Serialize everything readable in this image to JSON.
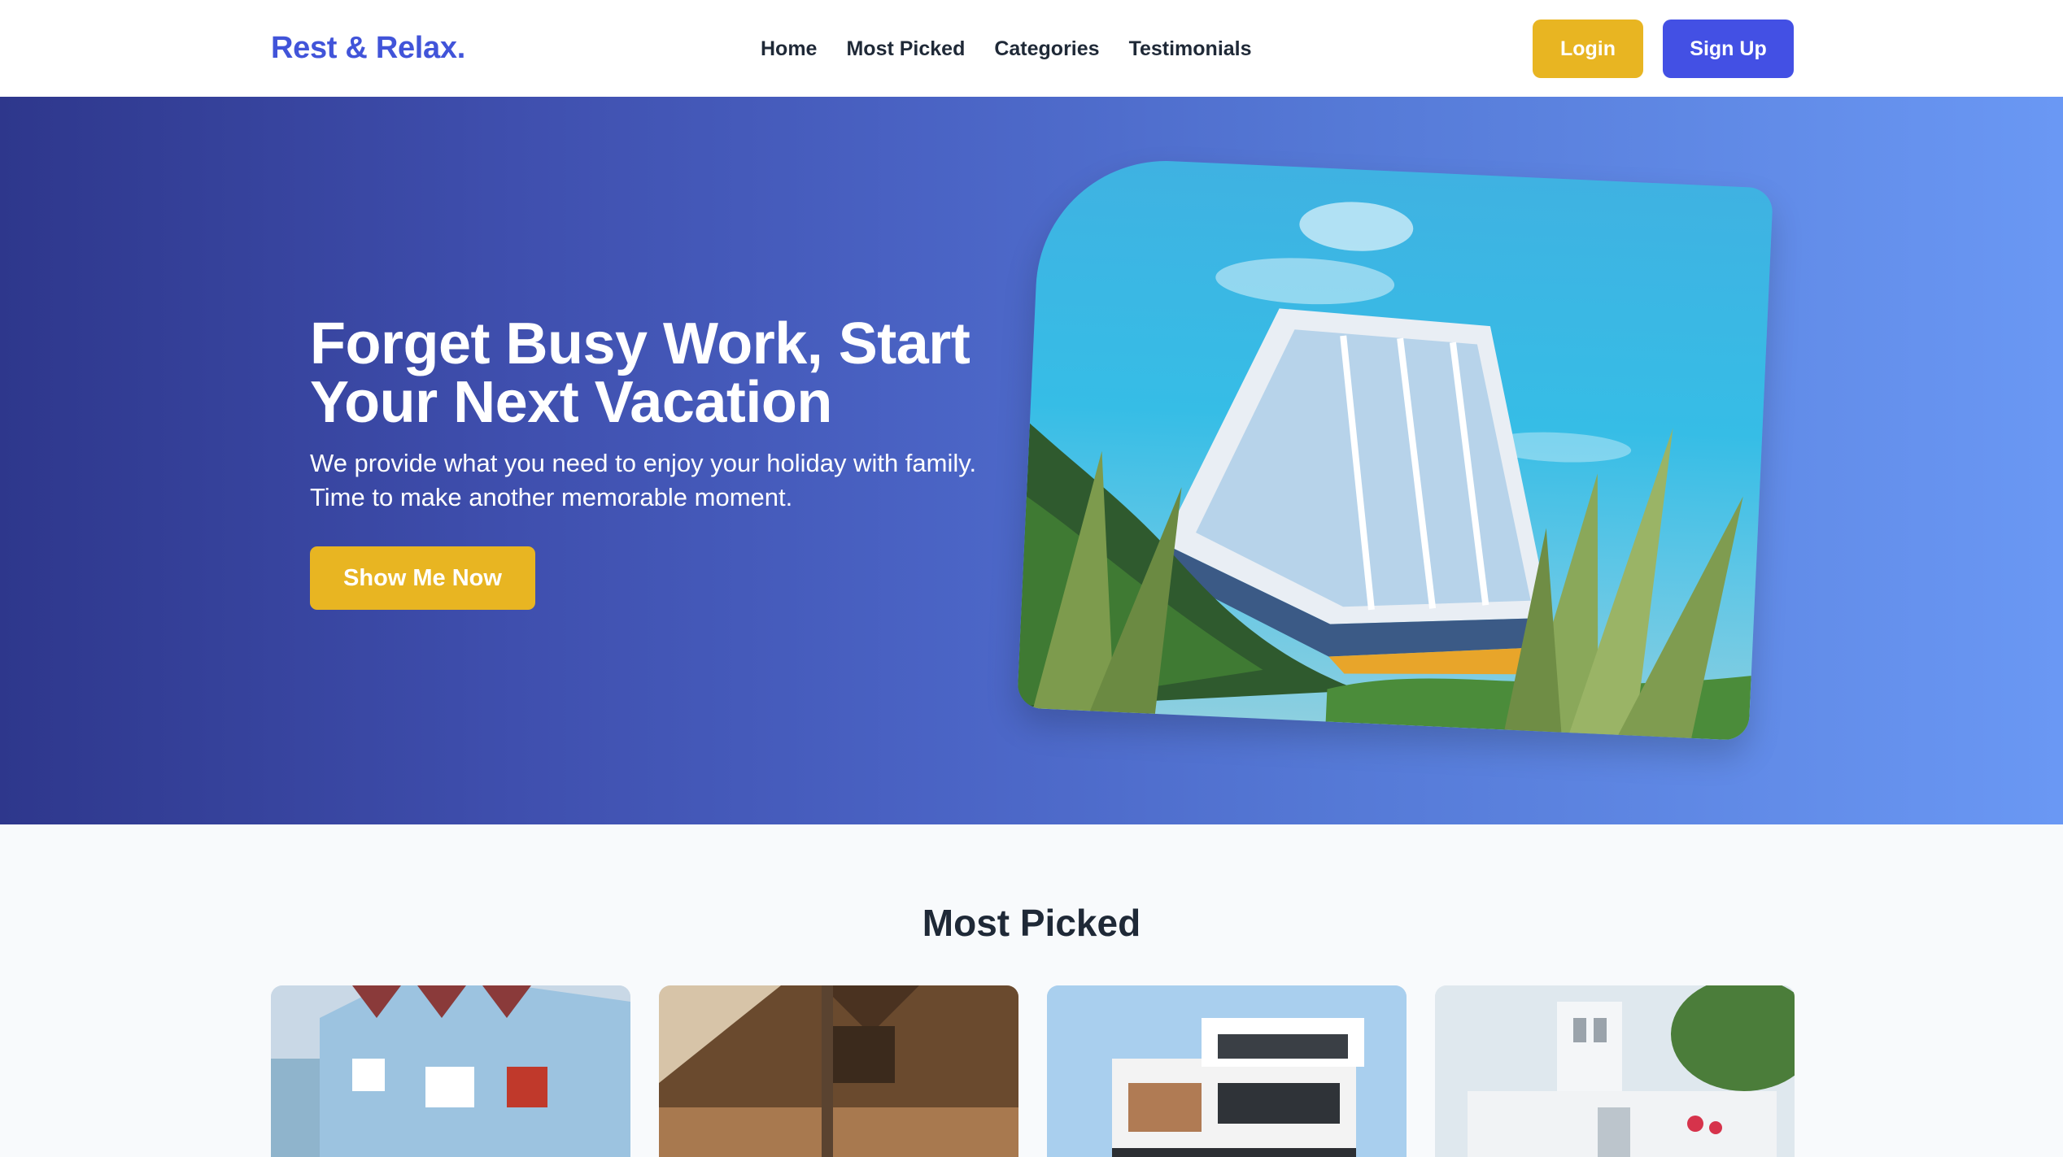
{
  "navbar": {
    "brand": "Rest & Relax.",
    "links": [
      "Home",
      "Most Picked",
      "Categories",
      "Testimonials"
    ],
    "login_label": "Login",
    "signup_label": "Sign Up"
  },
  "hero": {
    "title": "Forget Busy Work, Start Your Next Vacation",
    "subtitle": "We provide what you need to enjoy your holiday with family. Time to make another memorable moment.",
    "cta_label": "Show Me Now"
  },
  "most_picked": {
    "title": "Most Picked"
  },
  "colors": {
    "brand": "#4154d9",
    "accent_yellow": "#e8b522",
    "primary_blue": "#4350e4",
    "hero_gradient_start": "#2e378c",
    "hero_gradient_end": "#6a98f4",
    "text_dark": "#1f2937",
    "section_bg": "#f8fafc"
  }
}
